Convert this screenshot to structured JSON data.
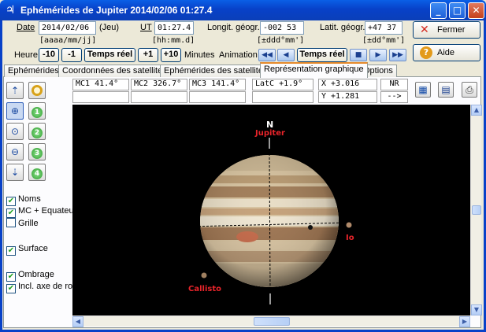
{
  "window": {
    "title": "Ephémérides de Jupiter  2014/02/06  01:27.4",
    "app_icon": "jupiter-symbol-icon",
    "minimize": "_",
    "maximize": "□",
    "close": "✕"
  },
  "form": {
    "date_label": "Date",
    "date_value": "2014/02/06",
    "weekday": "(Jeu)",
    "date_hint": "[aaaa/mm/jj]",
    "ut_label": "UT",
    "ut_value": "01:27.4",
    "ut_hint": "[hh:mm.d]",
    "longit_label": "Longit. géogr.",
    "longit_value": "-002 53",
    "longit_hint": "[±ddd°mm']",
    "latit_label": "Latit. géogr.",
    "latit_value": "+47 37",
    "latit_hint": "[±dd°mm']"
  },
  "buttons": {
    "fermer": "Fermer",
    "aide": "Aide"
  },
  "time_controls": {
    "heure_label": "Heure",
    "minus10": "-10",
    "minus1": "-1",
    "temps_reel": "Temps réel",
    "plus1": "+1",
    "plus10": "+10",
    "minutes_label": "Minutes",
    "animation_label": "Animation",
    "anim_temps_reel": "Temps réel"
  },
  "tabs": [
    {
      "label": "Ephémérides"
    },
    {
      "label": "Coordonnées des satellites"
    },
    {
      "label": "Ephémérides des satellites"
    },
    {
      "label": "Représentation graphique"
    },
    {
      "label": "Options"
    }
  ],
  "info": {
    "mc1": "MC1   41.4°",
    "mc2": "MC2 326.7°",
    "mc3": "MC3 141.4°",
    "latc": "LatC   +1.9°",
    "x": "X    +3.016",
    "y": "Y    +1.281",
    "nr": "NR",
    "arrow": "-->"
  },
  "checkboxes": {
    "noms": "Noms",
    "mc_equateur": "MC + Equateur",
    "grille": "Grille",
    "surface": "Surface",
    "ombrage": "Ombrage",
    "incl_axe": "Incl. axe de rot."
  },
  "tool_numbers": {
    "one": "1",
    "two": "2",
    "three": "3",
    "four": "4"
  },
  "view": {
    "north": "N",
    "jupiter": "Jupiter",
    "io": "Io",
    "callisto": "Callisto"
  }
}
